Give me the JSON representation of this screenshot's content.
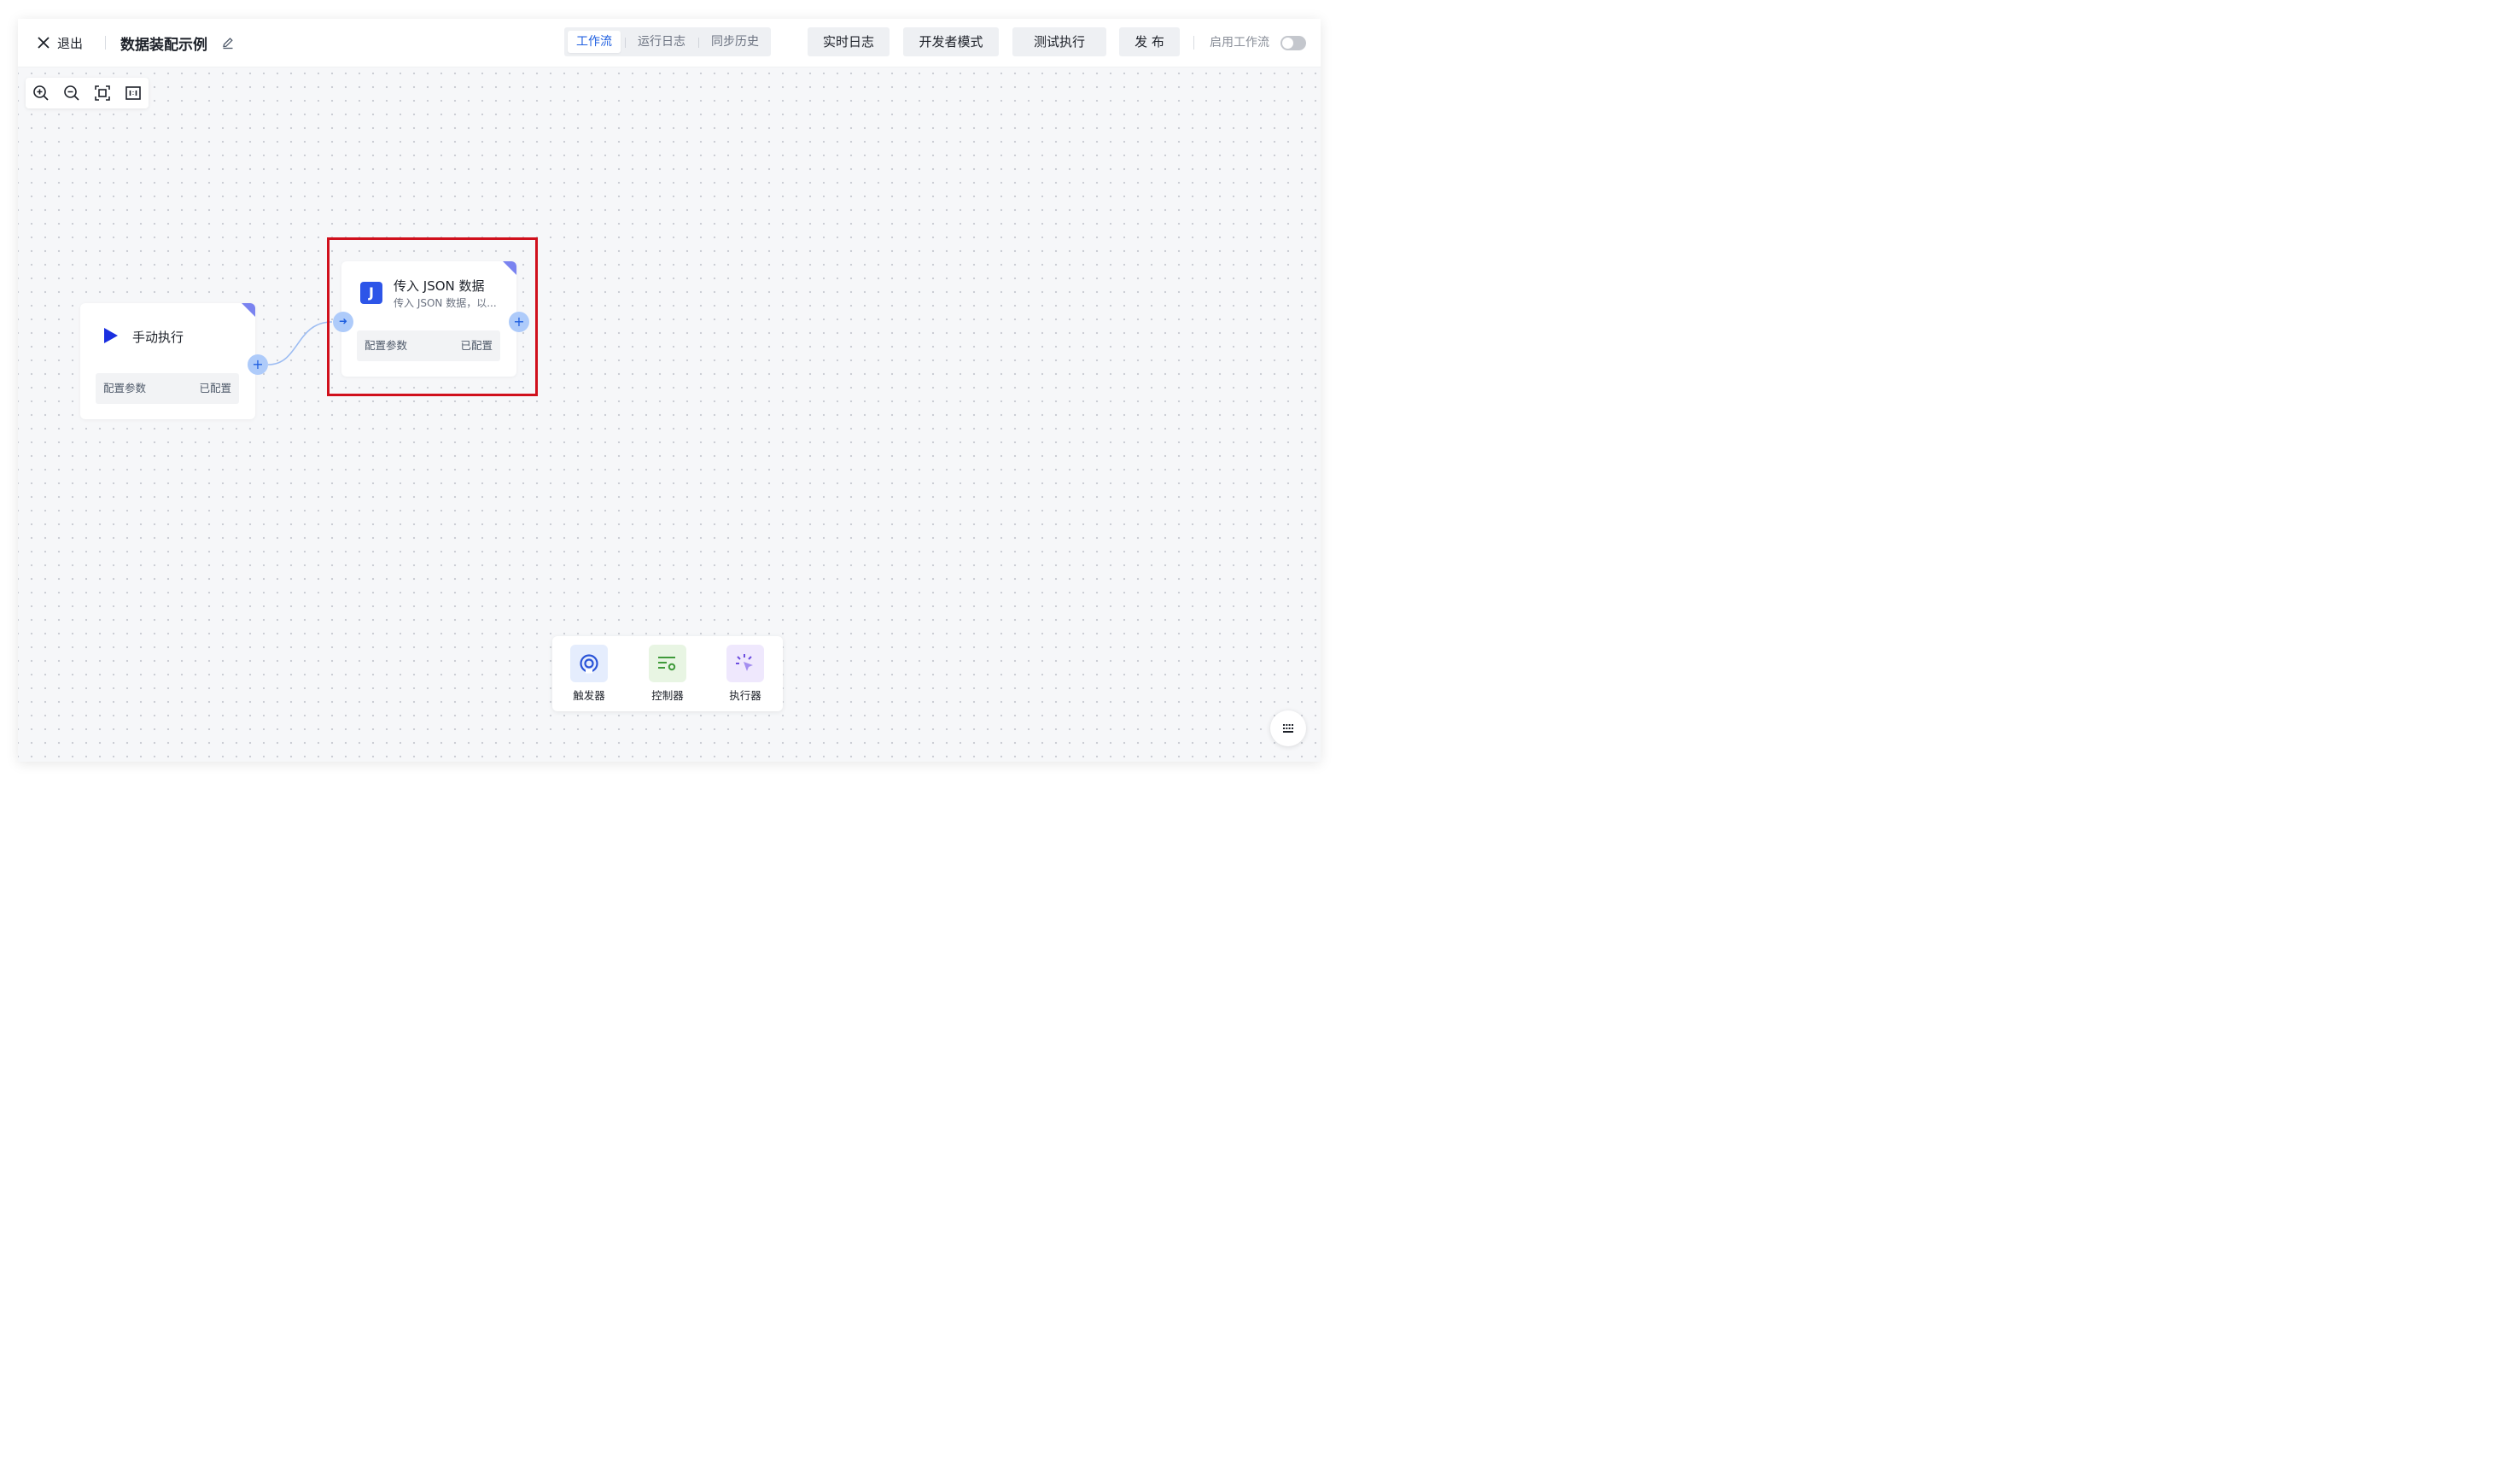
{
  "header": {
    "exit_label": "退出",
    "workflow_title": "数据装配示例",
    "tabs": [
      {
        "label": "工作流",
        "active": true
      },
      {
        "label": "运行日志",
        "active": false
      },
      {
        "label": "同步历史",
        "active": false
      }
    ],
    "buttons": {
      "realtime_log": "实时日志",
      "developer_mode": "开发者模式",
      "test_run": "测试执行",
      "publish": "发 布"
    },
    "enable_label": "启用工作流",
    "enable_on": false
  },
  "nodes": {
    "manual": {
      "title": "手动执行",
      "config_label": "配置参数",
      "config_status": "已配置"
    },
    "json": {
      "icon_letter": "J",
      "title": "传入 JSON 数据",
      "subtitle": "传入 JSON 数据，以...",
      "config_label": "配置参数",
      "config_status": "已配置"
    }
  },
  "palette": {
    "items": [
      {
        "label": "触发器",
        "icon": "trigger-icon"
      },
      {
        "label": "控制器",
        "icon": "controller-icon"
      },
      {
        "label": "执行器",
        "icon": "executor-icon"
      }
    ]
  },
  "colors": {
    "accent": "#1f5fe0",
    "highlight_border": "#d0101c",
    "node_corner": "#7a83f0",
    "json_icon_bg": "#2d55e8"
  }
}
